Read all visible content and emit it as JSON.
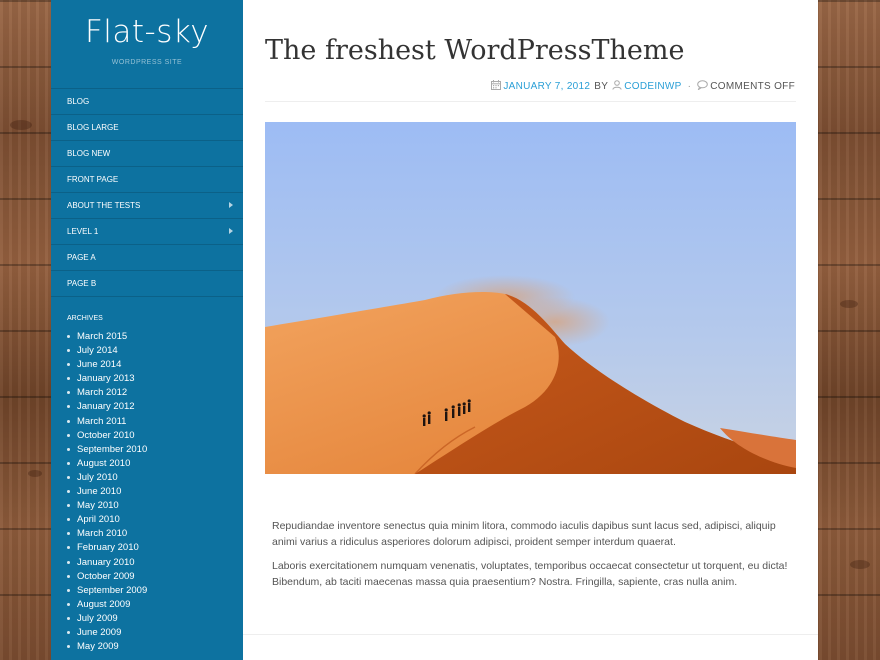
{
  "site": {
    "title": "Flat-sky",
    "description": "WORDPRESS SITE"
  },
  "menu": [
    {
      "label": "BLOG",
      "has_children": false
    },
    {
      "label": "BLOG LARGE",
      "has_children": false
    },
    {
      "label": "BLOG NEW",
      "has_children": false
    },
    {
      "label": "FRONT PAGE",
      "has_children": false
    },
    {
      "label": "ABOUT THE TESTS",
      "has_children": true
    },
    {
      "label": "LEVEL 1",
      "has_children": true
    },
    {
      "label": "PAGE A",
      "has_children": false
    },
    {
      "label": "PAGE B",
      "has_children": false
    }
  ],
  "archives": {
    "title": "ARCHIVES",
    "items": [
      "March 2015",
      "July 2014",
      "June 2014",
      "January 2013",
      "March 2012",
      "January 2012",
      "March 2011",
      "October 2010",
      "September 2010",
      "August 2010",
      "July 2010",
      "June 2010",
      "May 2010",
      "April 2010",
      "March 2010",
      "February 2010",
      "January 2010",
      "October 2009",
      "September 2009",
      "August 2009",
      "July 2009",
      "June 2009",
      "May 2009"
    ]
  },
  "post": {
    "title": "The freshest WordPressTheme",
    "date": "JANUARY 7, 2012",
    "by": "BY",
    "author": "CODEINWP",
    "separator": "·",
    "comments": "COMMENTS OFF",
    "paragraphs": [
      "Repudiandae inventore senectus quia minim litora, commodo iaculis dapibus sunt lacus sed, adipisci, aliquip animi varius a ridiculus asperiores dolorum adipisci, proident semper interdum quaerat.",
      "Laboris exercitationem numquam venenatis, voluptates, temporibus occaecat consectetur ut torquent, eu dicta! Bibendum, ab taciti maecenas massa quia praesentium? Nostra. Fringilla, sapiente, cras nulla anim."
    ]
  },
  "icons": {
    "calendar": "calendar-icon",
    "author": "user-icon",
    "comments": "comment-icon",
    "submenu": "chevron-right-icon"
  },
  "colors": {
    "sidebar": "#0d72a0",
    "link": "#2a9fd6",
    "title": "#333333"
  }
}
